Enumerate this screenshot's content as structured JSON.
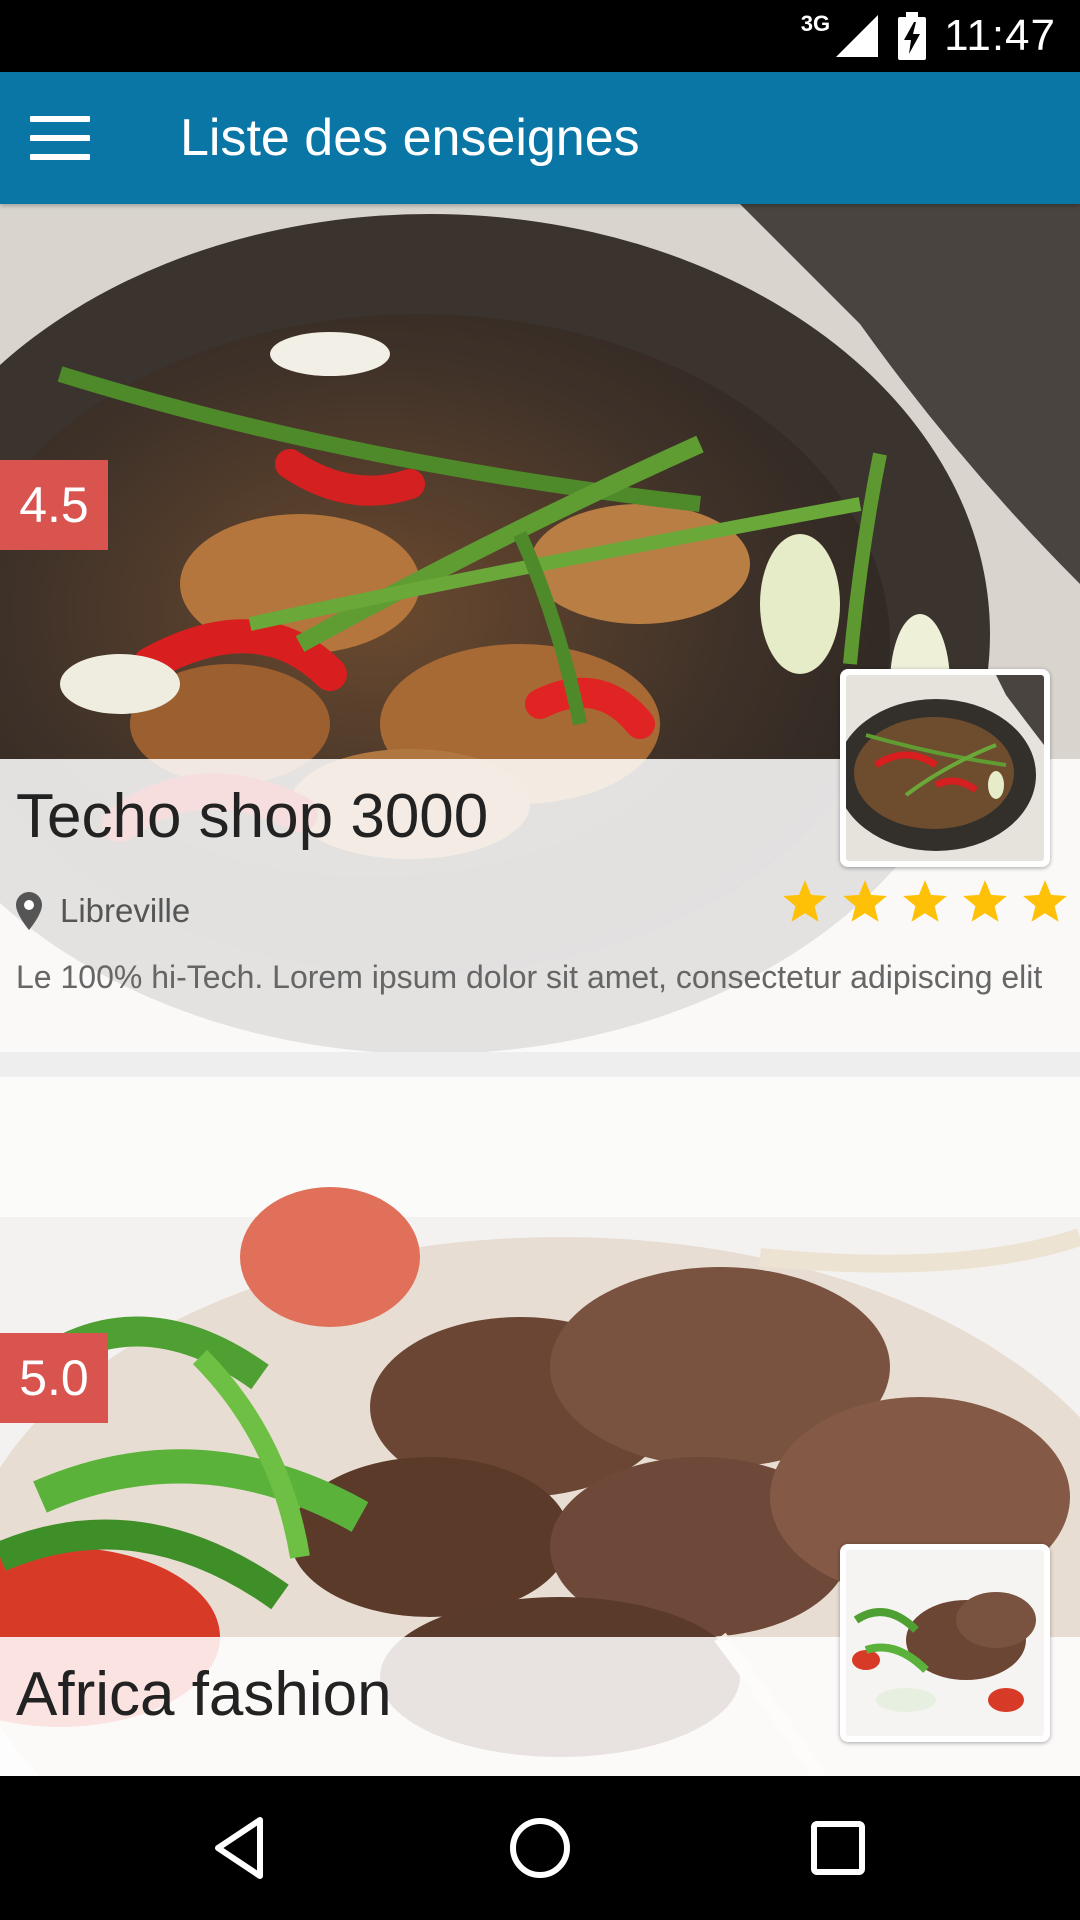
{
  "status_bar": {
    "network": "3G",
    "time": "11:47"
  },
  "app_bar": {
    "title": "Liste des enseignes"
  },
  "shops": [
    {
      "score": "4.5",
      "name": "Techo shop 3000",
      "city": "Libreville",
      "stars": 5,
      "description": "Le 100% hi-Tech. Lorem ipsum dolor sit amet, consectetur adipiscing elit"
    },
    {
      "score": "5.0",
      "name": "Africa fashion"
    }
  ],
  "colors": {
    "app_bar": "#0a76a5",
    "badge": "#d9534f",
    "star": "#ffc107"
  }
}
